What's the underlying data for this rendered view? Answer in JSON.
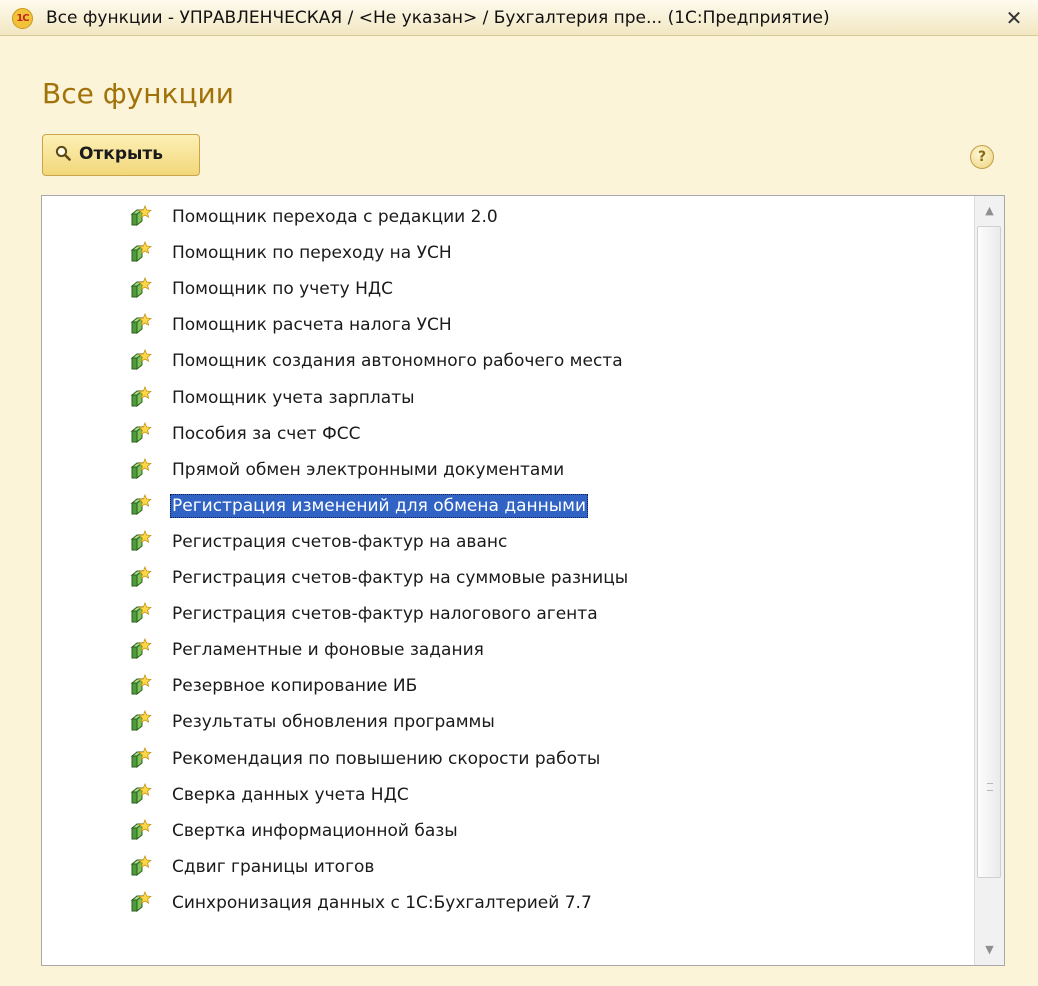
{
  "window": {
    "logo_text": "1С",
    "title": "Все функции - УПРАВЛЕНЧЕСКАЯ / <Не указан> / Бухгалтерия пре...  (1С:Предприятие)",
    "close_glyph": "✕"
  },
  "page": {
    "title": "Все функции"
  },
  "toolbar": {
    "open_label": "Открыть",
    "help_glyph": "?"
  },
  "list": {
    "items": [
      {
        "label": "Помощник перехода с редакции 2.0",
        "icon": "processing-icon"
      },
      {
        "label": "Помощник по переходу на УСН",
        "icon": "processing-icon"
      },
      {
        "label": "Помощник по учету НДС",
        "icon": "processing-icon"
      },
      {
        "label": "Помощник расчета налога УСН",
        "icon": "processing-icon"
      },
      {
        "label": "Помощник создания автономного рабочего места",
        "icon": "processing-icon"
      },
      {
        "label": "Помощник учета зарплаты",
        "icon": "processing-icon"
      },
      {
        "label": "Пособия за счет ФСС",
        "icon": "processing-icon"
      },
      {
        "label": "Прямой обмен электронными документами",
        "icon": "processing-icon"
      },
      {
        "label": "Регистрация изменений для обмена данными",
        "icon": "processing-icon",
        "selected": true
      },
      {
        "label": "Регистрация счетов-фактур на аванс",
        "icon": "processing-icon"
      },
      {
        "label": "Регистрация счетов-фактур на суммовые разницы",
        "icon": "processing-icon"
      },
      {
        "label": "Регистрация счетов-фактур налогового агента",
        "icon": "processing-icon"
      },
      {
        "label": "Регламентные и фоновые задания",
        "icon": "processing-icon"
      },
      {
        "label": "Резервное копирование ИБ",
        "icon": "processing-icon"
      },
      {
        "label": "Результаты обновления программы",
        "icon": "processing-icon"
      },
      {
        "label": "Рекомендация по повышению скорости работы",
        "icon": "processing-icon"
      },
      {
        "label": "Сверка данных учета НДС",
        "icon": "processing-icon"
      },
      {
        "label": "Свертка информационной базы",
        "icon": "processing-icon"
      },
      {
        "label": "Сдвиг границы итогов",
        "icon": "processing-icon"
      },
      {
        "label": "Синхронизация данных с 1С:Бухгалтерией 7.7",
        "icon": "processing-icon"
      }
    ],
    "scroll_up_glyph": "▲",
    "scroll_down_glyph": "▼"
  },
  "colors": {
    "background": "#fbf4d8",
    "title_accent": "#a2720a",
    "selection": "#3063c4"
  }
}
